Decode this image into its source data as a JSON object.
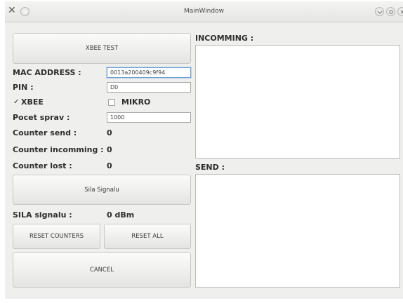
{
  "window": {
    "title": "MainWindow"
  },
  "titlebar_icons": [
    "close-x-icon",
    "app-circle-icon",
    "minimize-icon",
    "maximize-icon",
    "close-icon"
  ],
  "left_panel": {
    "xbee_test_button": "XBEE TEST",
    "mac_address": {
      "label": "MAC ADDRESS :",
      "value": "0013a200409c9f94"
    },
    "pin": {
      "label": "PIN :",
      "value": "D0"
    },
    "xbee_option": {
      "label": "XBEE",
      "checked": true
    },
    "mikro_option": {
      "label": "MIKRO",
      "checked": false
    },
    "pocet_sprav": {
      "label": "Pocet sprav :",
      "value": "1000"
    },
    "counter_send": {
      "label": "Counter send :",
      "value": "0"
    },
    "counter_incomming": {
      "label": "Counter incomming :",
      "value": "0"
    },
    "counter_lost": {
      "label": "Counter lost :",
      "value": "0"
    },
    "sila_signalu_button": "Sila Signalu",
    "sila_signalu": {
      "label": "SILA signalu :",
      "value": "0 dBm"
    },
    "reset_counters_button": "RESET COUNTERS",
    "reset_all_button": "RESET ALL",
    "cancel_button": "CANCEL"
  },
  "right_panel": {
    "incomming_label": "INCOMMING :",
    "send_label": "SEND :"
  },
  "colors": {
    "window_bg": "#efefee",
    "focus_border": "#6f9fd1",
    "text": "#2e2e2e"
  }
}
